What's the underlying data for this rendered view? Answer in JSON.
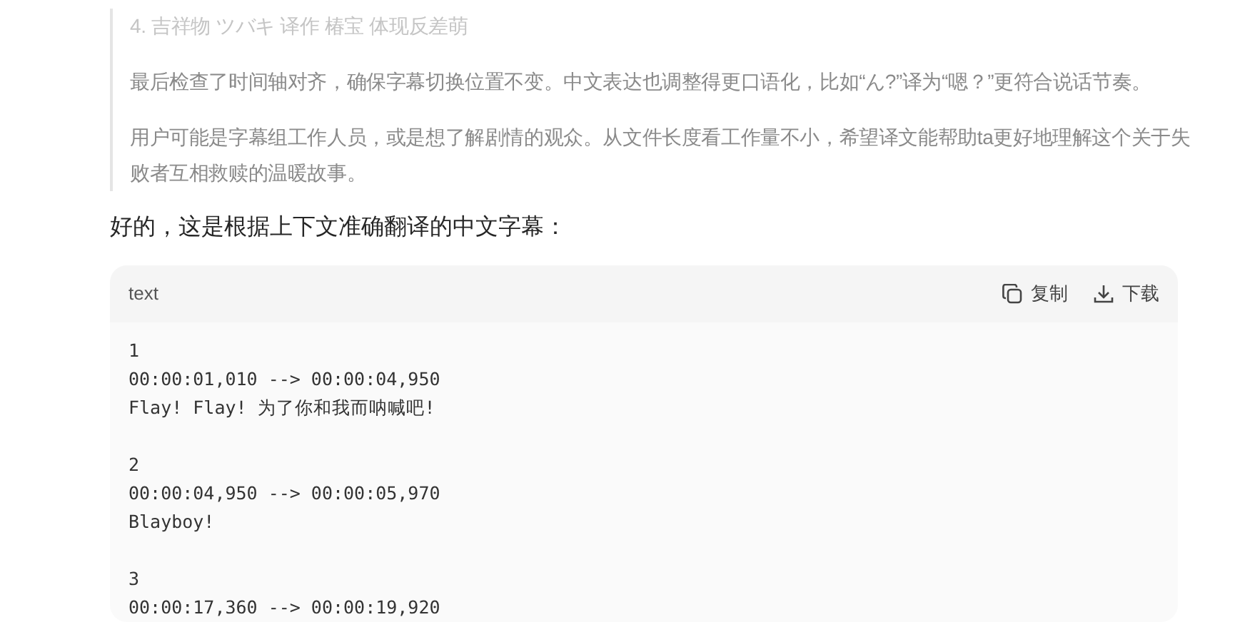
{
  "thinking": {
    "paragraphs": [
      "4. 吉祥物 ツバキ 译作 椿宝 体现反差萌",
      "最后检查了时间轴对齐，确保字幕切换位置不变。中文表达也调整得更口语化，比如“ん?”译为“嗯？”更符合说话节奏。",
      "用户可能是字幕组工作人员，或是想了解剧情的观众。从文件长度看工作量不小，希望译文能帮助ta更好地理解这个关于失败者互相救赎的温暖故事。"
    ]
  },
  "answer": "好的，这是根据上下文准确翻译的中文字幕：",
  "code_block": {
    "language": "text",
    "actions": [
      {
        "kind": "copy",
        "label": "复制"
      },
      {
        "kind": "download",
        "label": "下载"
      }
    ],
    "entries": [
      {
        "index": "1",
        "time": "00:00:01,010 --> 00:00:04,950",
        "text": "Flay! Flay! 为了你和我而呐喊吧!"
      },
      {
        "index": "2",
        "time": "00:00:04,950 --> 00:00:05,970",
        "text": "Blayboy!"
      },
      {
        "index": "3",
        "time": "00:00:17,360 --> 00:00:19,920"
      }
    ]
  }
}
